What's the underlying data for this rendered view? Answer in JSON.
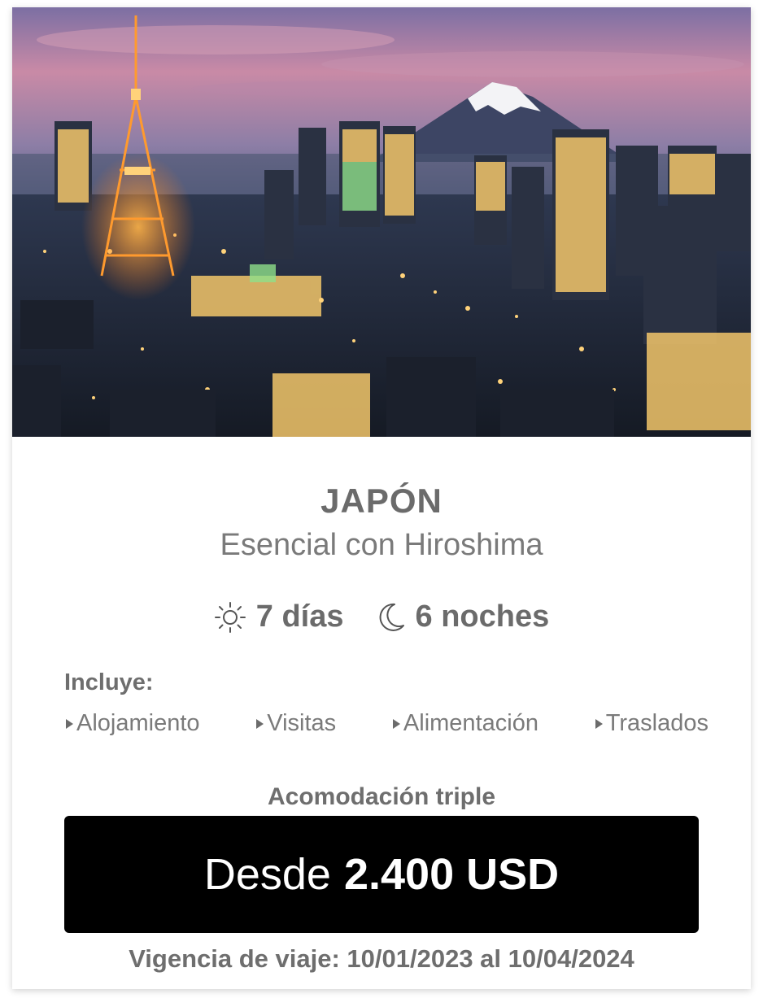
{
  "destination": {
    "title": "JAPÓN",
    "subtitle": "Esencial con Hiroshima"
  },
  "duration": {
    "days": "7 días",
    "nights": "6 noches",
    "days_icon": "sun-icon",
    "nights_icon": "moon-icon"
  },
  "includes": {
    "label": "Incluye:",
    "items": [
      "Alojamiento",
      "Visitas",
      "Alimentación",
      "Traslados"
    ]
  },
  "accommodation": "Acomodación triple",
  "price": {
    "prefix": "Desde",
    "value": "2.400 USD"
  },
  "validity": "Vigencia de viaje: 10/01/2023 al 10/04/2024",
  "colors": {
    "text_gray": "#6b6b6b",
    "price_bg": "#000000",
    "price_text": "#ffffff"
  }
}
